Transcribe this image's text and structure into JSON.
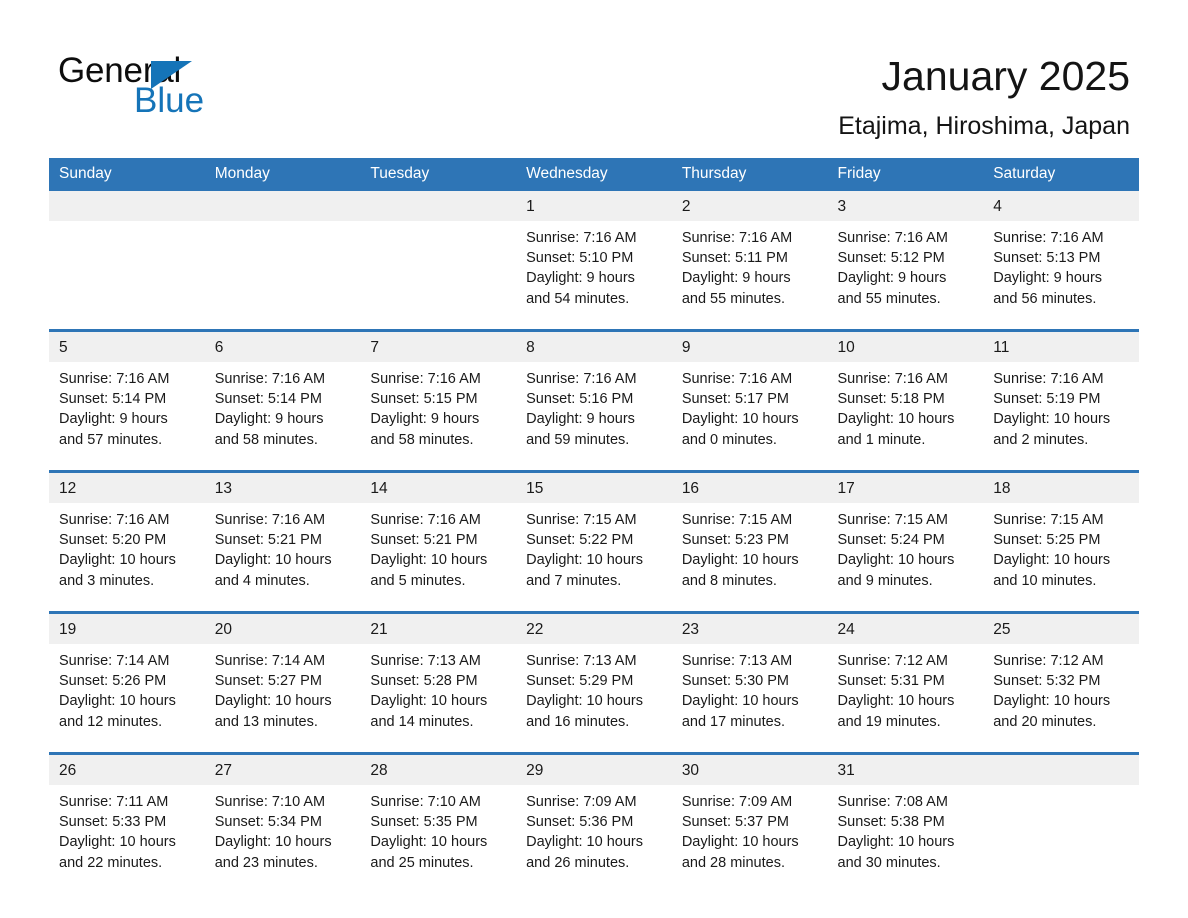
{
  "brand": {
    "name_part1": "General",
    "name_part2": "Blue",
    "accent_color": "#1574b8"
  },
  "header": {
    "title": "January 2025",
    "subtitle": "Etajima, Hiroshima, Japan",
    "header_bg_color": "#2e75b6"
  },
  "calendar": {
    "weekday_headers": [
      "Sunday",
      "Monday",
      "Tuesday",
      "Wednesday",
      "Thursday",
      "Friday",
      "Saturday"
    ],
    "weeks": [
      [
        {
          "day": "",
          "sunrise": "",
          "sunset": "",
          "daylight": "",
          "empty": true
        },
        {
          "day": "",
          "sunrise": "",
          "sunset": "",
          "daylight": "",
          "empty": true
        },
        {
          "day": "",
          "sunrise": "",
          "sunset": "",
          "daylight": "",
          "empty": true
        },
        {
          "day": "1",
          "sunrise": "Sunrise: 7:16 AM",
          "sunset": "Sunset: 5:10 PM",
          "daylight": "Daylight: 9 hours and 54 minutes."
        },
        {
          "day": "2",
          "sunrise": "Sunrise: 7:16 AM",
          "sunset": "Sunset: 5:11 PM",
          "daylight": "Daylight: 9 hours and 55 minutes."
        },
        {
          "day": "3",
          "sunrise": "Sunrise: 7:16 AM",
          "sunset": "Sunset: 5:12 PM",
          "daylight": "Daylight: 9 hours and 55 minutes."
        },
        {
          "day": "4",
          "sunrise": "Sunrise: 7:16 AM",
          "sunset": "Sunset: 5:13 PM",
          "daylight": "Daylight: 9 hours and 56 minutes."
        }
      ],
      [
        {
          "day": "5",
          "sunrise": "Sunrise: 7:16 AM",
          "sunset": "Sunset: 5:14 PM",
          "daylight": "Daylight: 9 hours and 57 minutes."
        },
        {
          "day": "6",
          "sunrise": "Sunrise: 7:16 AM",
          "sunset": "Sunset: 5:14 PM",
          "daylight": "Daylight: 9 hours and 58 minutes."
        },
        {
          "day": "7",
          "sunrise": "Sunrise: 7:16 AM",
          "sunset": "Sunset: 5:15 PM",
          "daylight": "Daylight: 9 hours and 58 minutes."
        },
        {
          "day": "8",
          "sunrise": "Sunrise: 7:16 AM",
          "sunset": "Sunset: 5:16 PM",
          "daylight": "Daylight: 9 hours and 59 minutes."
        },
        {
          "day": "9",
          "sunrise": "Sunrise: 7:16 AM",
          "sunset": "Sunset: 5:17 PM",
          "daylight": "Daylight: 10 hours and 0 minutes."
        },
        {
          "day": "10",
          "sunrise": "Sunrise: 7:16 AM",
          "sunset": "Sunset: 5:18 PM",
          "daylight": "Daylight: 10 hours and 1 minute."
        },
        {
          "day": "11",
          "sunrise": "Sunrise: 7:16 AM",
          "sunset": "Sunset: 5:19 PM",
          "daylight": "Daylight: 10 hours and 2 minutes."
        }
      ],
      [
        {
          "day": "12",
          "sunrise": "Sunrise: 7:16 AM",
          "sunset": "Sunset: 5:20 PM",
          "daylight": "Daylight: 10 hours and 3 minutes."
        },
        {
          "day": "13",
          "sunrise": "Sunrise: 7:16 AM",
          "sunset": "Sunset: 5:21 PM",
          "daylight": "Daylight: 10 hours and 4 minutes."
        },
        {
          "day": "14",
          "sunrise": "Sunrise: 7:16 AM",
          "sunset": "Sunset: 5:21 PM",
          "daylight": "Daylight: 10 hours and 5 minutes."
        },
        {
          "day": "15",
          "sunrise": "Sunrise: 7:15 AM",
          "sunset": "Sunset: 5:22 PM",
          "daylight": "Daylight: 10 hours and 7 minutes."
        },
        {
          "day": "16",
          "sunrise": "Sunrise: 7:15 AM",
          "sunset": "Sunset: 5:23 PM",
          "daylight": "Daylight: 10 hours and 8 minutes."
        },
        {
          "day": "17",
          "sunrise": "Sunrise: 7:15 AM",
          "sunset": "Sunset: 5:24 PM",
          "daylight": "Daylight: 10 hours and 9 minutes."
        },
        {
          "day": "18",
          "sunrise": "Sunrise: 7:15 AM",
          "sunset": "Sunset: 5:25 PM",
          "daylight": "Daylight: 10 hours and 10 minutes."
        }
      ],
      [
        {
          "day": "19",
          "sunrise": "Sunrise: 7:14 AM",
          "sunset": "Sunset: 5:26 PM",
          "daylight": "Daylight: 10 hours and 12 minutes."
        },
        {
          "day": "20",
          "sunrise": "Sunrise: 7:14 AM",
          "sunset": "Sunset: 5:27 PM",
          "daylight": "Daylight: 10 hours and 13 minutes."
        },
        {
          "day": "21",
          "sunrise": "Sunrise: 7:13 AM",
          "sunset": "Sunset: 5:28 PM",
          "daylight": "Daylight: 10 hours and 14 minutes."
        },
        {
          "day": "22",
          "sunrise": "Sunrise: 7:13 AM",
          "sunset": "Sunset: 5:29 PM",
          "daylight": "Daylight: 10 hours and 16 minutes."
        },
        {
          "day": "23",
          "sunrise": "Sunrise: 7:13 AM",
          "sunset": "Sunset: 5:30 PM",
          "daylight": "Daylight: 10 hours and 17 minutes."
        },
        {
          "day": "24",
          "sunrise": "Sunrise: 7:12 AM",
          "sunset": "Sunset: 5:31 PM",
          "daylight": "Daylight: 10 hours and 19 minutes."
        },
        {
          "day": "25",
          "sunrise": "Sunrise: 7:12 AM",
          "sunset": "Sunset: 5:32 PM",
          "daylight": "Daylight: 10 hours and 20 minutes."
        }
      ],
      [
        {
          "day": "26",
          "sunrise": "Sunrise: 7:11 AM",
          "sunset": "Sunset: 5:33 PM",
          "daylight": "Daylight: 10 hours and 22 minutes."
        },
        {
          "day": "27",
          "sunrise": "Sunrise: 7:10 AM",
          "sunset": "Sunset: 5:34 PM",
          "daylight": "Daylight: 10 hours and 23 minutes."
        },
        {
          "day": "28",
          "sunrise": "Sunrise: 7:10 AM",
          "sunset": "Sunset: 5:35 PM",
          "daylight": "Daylight: 10 hours and 25 minutes."
        },
        {
          "day": "29",
          "sunrise": "Sunrise: 7:09 AM",
          "sunset": "Sunset: 5:36 PM",
          "daylight": "Daylight: 10 hours and 26 minutes."
        },
        {
          "day": "30",
          "sunrise": "Sunrise: 7:09 AM",
          "sunset": "Sunset: 5:37 PM",
          "daylight": "Daylight: 10 hours and 28 minutes."
        },
        {
          "day": "31",
          "sunrise": "Sunrise: 7:08 AM",
          "sunset": "Sunset: 5:38 PM",
          "daylight": "Daylight: 10 hours and 30 minutes."
        },
        {
          "day": "",
          "sunrise": "",
          "sunset": "",
          "daylight": "",
          "empty": true
        }
      ]
    ]
  }
}
